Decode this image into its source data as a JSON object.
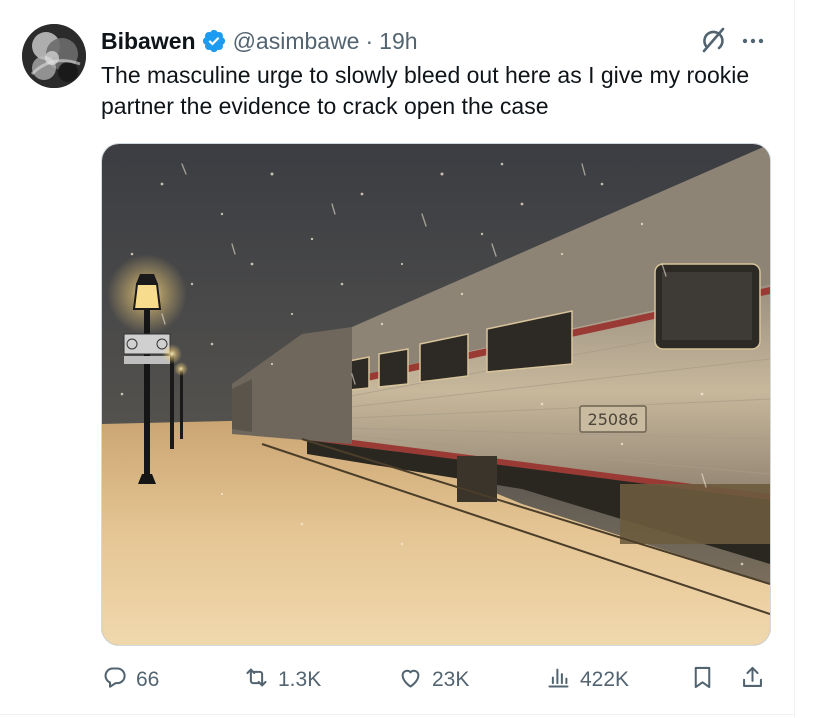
{
  "tweet": {
    "author": {
      "display_name": "Bibawen",
      "handle": "@asimbawe",
      "verified": true
    },
    "separator": "·",
    "time": "19h",
    "text": "The masculine urge to slowly bleed out here as I give my rookie partner the evidence to crack open the case",
    "media": {
      "car_number": "25086"
    },
    "actions": {
      "replies": "66",
      "retweets": "1.3K",
      "likes": "23K",
      "views": "422K"
    }
  },
  "icons": {
    "verified": "verified-badge-icon",
    "grok": "grok-icon",
    "more": "more-icon",
    "reply": "reply-icon",
    "retweet": "retweet-icon",
    "like": "like-icon",
    "views": "views-icon",
    "bookmark": "bookmark-icon",
    "share": "share-icon"
  },
  "colors": {
    "text_primary": "#0f1419",
    "text_secondary": "#536471",
    "verified_blue": "#1d9bf0",
    "divider": "#eff3f4"
  }
}
